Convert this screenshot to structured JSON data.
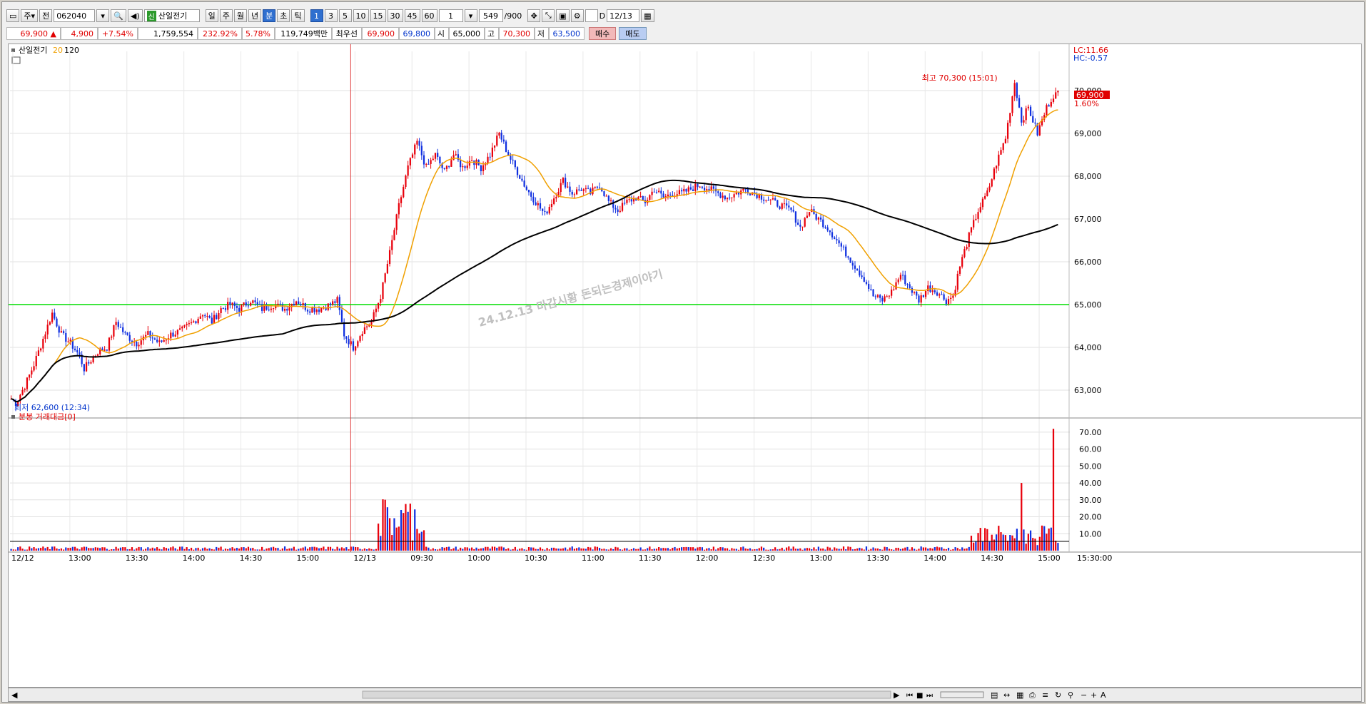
{
  "toolbar": {
    "type_left": "주",
    "mode": "전",
    "stock_code": "062040",
    "stock_name": "산일전기",
    "name_badge": "신",
    "periods": [
      "일",
      "주",
      "월",
      "년",
      "분",
      "초",
      "틱"
    ],
    "selected_period": "분",
    "intervals": [
      "1",
      "3",
      "5",
      "10",
      "15",
      "30",
      "45",
      "60"
    ],
    "selected_interval": "1",
    "multiplier": "1",
    "count": "549",
    "count_total": "/900",
    "checkbox_label": "D",
    "date": "12/13"
  },
  "quote": {
    "price": "69,900",
    "arrow": "▲",
    "change": "4,900",
    "change_pct": "+7.54%",
    "volume": "1,759,554",
    "volume_ratio": "232.92%",
    "turnover": "5.78%",
    "amount": "119,749백만",
    "best_label": "최우선",
    "best_ask": "69,900",
    "best_bid": "69,800",
    "open_label": "시",
    "open": "65,000",
    "high_label": "고",
    "high": "70,300",
    "low_label": "저",
    "low": "63,500",
    "buy_button": "매수",
    "sell_button": "매도"
  },
  "price_panel": {
    "legend_name": "산일전기",
    "ma_short": "20",
    "ma_long": "120",
    "lc": "LC:11.66",
    "hc": "HC:-0.57",
    "current_price": "69,900",
    "current_pct": "1.60%",
    "high_annotation": "최고 70,300 (15:01)",
    "low_annotation": "최저 62,600 (12:34)",
    "watermark": "24.12.13 마감시황 돈되는경제이야기",
    "y_labels": [
      "70,000",
      "69,000",
      "68,000",
      "67,000",
      "66,000",
      "65,000",
      "64,000",
      "63,000"
    ]
  },
  "volume_panel": {
    "legend": "분봉 거래대금[0]",
    "y_labels": [
      "70.00",
      "60.00",
      "50.00",
      "40.00",
      "30.00",
      "20.00",
      "10.00"
    ]
  },
  "x_axis": {
    "labels": [
      "12/12",
      "13:00",
      "13:30",
      "14:00",
      "14:30",
      "15:00",
      "12/13",
      "09:30",
      "10:00",
      "10:30",
      "11:00",
      "11:30",
      "12:00",
      "12:30",
      "13:00",
      "13:30",
      "14:00",
      "14:30",
      "15:00"
    ],
    "end_label": "15:30:00"
  },
  "colors": {
    "up": "#e8000b",
    "down": "#1030e0",
    "ma20": "#f0a000",
    "ma120": "#000000",
    "support": "#00dd00"
  },
  "chart_data": {
    "type": "candlestick",
    "support_line": 65000,
    "ylim_price": [
      62450,
      70750
    ],
    "ylim_volume": [
      0,
      75
    ],
    "day_boundary": "12/13",
    "series": [
      {
        "name": "산일전기",
        "anchors": [
          [
            0,
            62800
          ],
          [
            2,
            62700
          ],
          [
            6,
            63100
          ],
          [
            10,
            63600
          ],
          [
            14,
            64200
          ],
          [
            18,
            64800
          ],
          [
            22,
            64300
          ],
          [
            26,
            64100
          ],
          [
            30,
            63800
          ],
          [
            32,
            63500
          ],
          [
            38,
            63900
          ],
          [
            42,
            64000
          ],
          [
            46,
            64600
          ],
          [
            50,
            64300
          ],
          [
            55,
            64100
          ],
          [
            60,
            64300
          ],
          [
            65,
            64100
          ],
          [
            70,
            64300
          ],
          [
            75,
            64400
          ],
          [
            80,
            64600
          ],
          [
            84,
            64800
          ],
          [
            88,
            64600
          ],
          [
            92,
            64900
          ],
          [
            96,
            65000
          ],
          [
            100,
            64900
          ],
          [
            105,
            65100
          ],
          [
            110,
            64900
          ],
          [
            115,
            65000
          ],
          [
            120,
            64900
          ],
          [
            125,
            65100
          ],
          [
            130,
            64900
          ],
          [
            135,
            64900
          ],
          [
            140,
            65000
          ],
          [
            143,
            65100
          ],
          [
            146,
            64300
          ],
          [
            150,
            64000
          ],
          [
            154,
            64400
          ],
          [
            158,
            64600
          ],
          [
            162,
            65200
          ],
          [
            166,
            66200
          ],
          [
            170,
            67300
          ],
          [
            174,
            68200
          ],
          [
            178,
            68800
          ],
          [
            182,
            68200
          ],
          [
            186,
            68500
          ],
          [
            190,
            68100
          ],
          [
            194,
            68500
          ],
          [
            198,
            68200
          ],
          [
            202,
            68400
          ],
          [
            206,
            68200
          ],
          [
            210,
            68500
          ],
          [
            214,
            69000
          ],
          [
            218,
            68500
          ],
          [
            222,
            68100
          ],
          [
            226,
            67700
          ],
          [
            230,
            67400
          ],
          [
            234,
            67100
          ],
          [
            238,
            67500
          ],
          [
            242,
            67900
          ],
          [
            246,
            67600
          ],
          [
            250,
            67700
          ],
          [
            254,
            67600
          ],
          [
            258,
            67800
          ],
          [
            262,
            67400
          ],
          [
            266,
            67200
          ],
          [
            270,
            67400
          ],
          [
            274,
            67500
          ],
          [
            278,
            67400
          ],
          [
            282,
            67700
          ],
          [
            286,
            67500
          ],
          [
            290,
            67600
          ],
          [
            294,
            67600
          ],
          [
            298,
            67700
          ],
          [
            302,
            67800
          ],
          [
            306,
            67700
          ],
          [
            310,
            67600
          ],
          [
            314,
            67500
          ],
          [
            318,
            67600
          ],
          [
            322,
            67700
          ],
          [
            326,
            67600
          ],
          [
            330,
            67500
          ],
          [
            334,
            67400
          ],
          [
            338,
            67300
          ],
          [
            342,
            67200
          ],
          [
            346,
            66800
          ],
          [
            350,
            67200
          ],
          [
            354,
            67000
          ],
          [
            358,
            66800
          ],
          [
            362,
            66500
          ],
          [
            366,
            66200
          ],
          [
            370,
            65900
          ],
          [
            374,
            65600
          ],
          [
            378,
            65200
          ],
          [
            382,
            65100
          ],
          [
            386,
            65300
          ],
          [
            390,
            65700
          ],
          [
            394,
            65400
          ],
          [
            398,
            65100
          ],
          [
            402,
            65400
          ],
          [
            406,
            65300
          ],
          [
            410,
            65100
          ],
          [
            413,
            65200
          ],
          [
            416,
            65900
          ],
          [
            420,
            66600
          ],
          [
            424,
            67200
          ],
          [
            428,
            67600
          ],
          [
            432,
            68300
          ],
          [
            436,
            68900
          ],
          [
            440,
            70200
          ],
          [
            443,
            69300
          ],
          [
            446,
            69600
          ],
          [
            450,
            69000
          ],
          [
            454,
            69600
          ],
          [
            457,
            69900
          ]
        ]
      }
    ],
    "ma20_series": {
      "name": "20"
    },
    "ma120_series": {
      "name": "120"
    }
  }
}
